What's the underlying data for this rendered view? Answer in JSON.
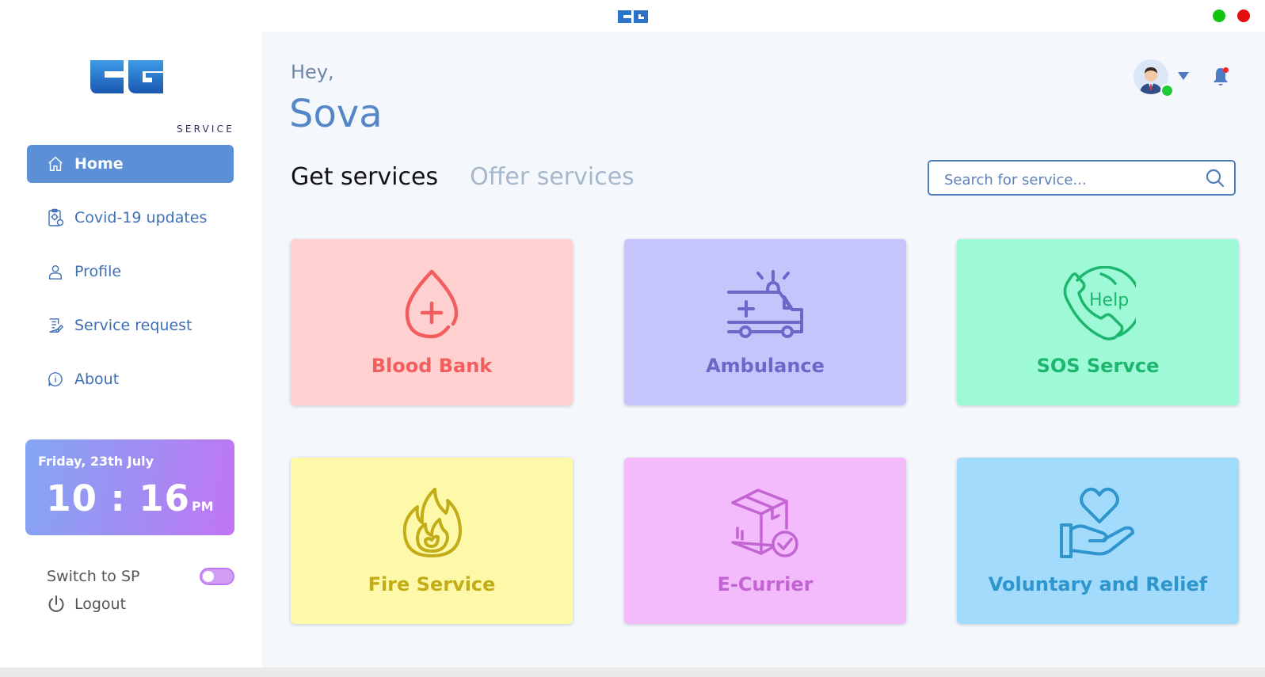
{
  "app": {
    "logo_text": "EG",
    "brand_sub": "SERVICE"
  },
  "sidebar": {
    "items": [
      {
        "label": "Home",
        "icon": "home-icon",
        "active": true
      },
      {
        "label": "Covid-19 updates",
        "icon": "clipboard-virus-icon"
      },
      {
        "label": "Profile",
        "icon": "user-icon"
      },
      {
        "label": "Service request",
        "icon": "document-edit-icon"
      },
      {
        "label": "About",
        "icon": "info-bubble-icon"
      }
    ],
    "clock": {
      "date": "Friday, 23th July",
      "time": "10 : 16",
      "ampm": "PM"
    },
    "switch_label": "Switch to SP",
    "switch_on": false,
    "logout_label": "Logout"
  },
  "header": {
    "greeting": "Hey,",
    "username": "Sova",
    "status": "online",
    "notification_unread": true
  },
  "tabs": [
    {
      "label": "Get services",
      "active": true
    },
    {
      "label": "Offer services",
      "active": false
    }
  ],
  "search": {
    "placeholder": "Search for service...",
    "value": ""
  },
  "services": [
    {
      "label": "Blood Bank",
      "icon": "blood-drop-icon",
      "bg": "#ffd0d0",
      "color": "#f25e5e"
    },
    {
      "label": "Ambulance",
      "icon": "ambulance-icon",
      "bg": "#c6c5fb",
      "color": "#6a68c9"
    },
    {
      "label": "SOS Servce",
      "icon": "help-phone-icon",
      "icon_text": "Help",
      "bg": "#9ef9d6",
      "color": "#1cb66e"
    },
    {
      "label": "Fire Service",
      "icon": "fire-icon",
      "bg": "#fdf9a8",
      "color": "#c2ad18"
    },
    {
      "label": "E-Currier",
      "icon": "package-check-icon",
      "bg": "#f3bbfb",
      "color": "#c264d2"
    },
    {
      "label": "Voluntary and Relief",
      "icon": "hand-heart-icon",
      "bg": "#a2dbfb",
      "color": "#2f95cd"
    }
  ],
  "colors": {
    "accent": "#5b8fd6",
    "nav_text": "#3f6fb4",
    "background": "#f4f8fc"
  }
}
